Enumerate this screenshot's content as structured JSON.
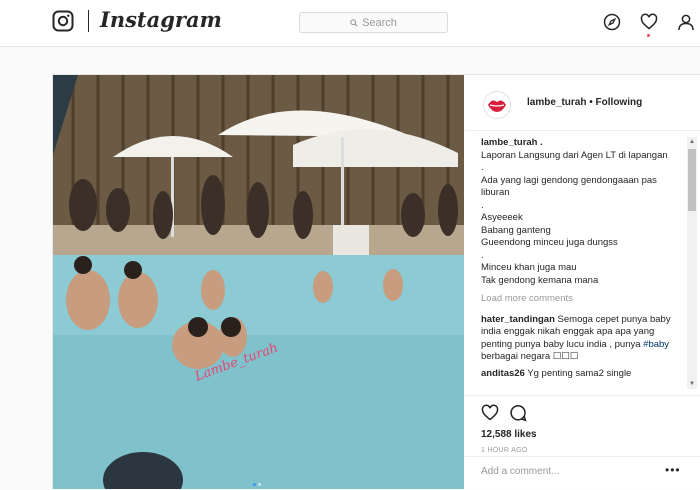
{
  "app": {
    "name": "Instagram",
    "search_placeholder": "Search"
  },
  "post": {
    "username": "lambe_turah",
    "follow_separator": "•",
    "follow_status": "Following",
    "caption_user": "lambe_turah",
    "caption_lines": [
      "lambe_turah .",
      "Laporan Langsung dari Agen LT di lapangan",
      ".",
      "Ada yang lagi gendong gendongaaan pas liburan",
      ".",
      "Asyeeeek",
      "Babang ganteng",
      "Gueendong minceu juga dungss",
      ".",
      "Minceu khan juga mau",
      "Tak gendong kemana mana"
    ],
    "load_more": "Load more comments",
    "comments": [
      {
        "user": "hater_tandingan",
        "text": "Semoga cepet punya baby india enggak nikah enggak apa apa yang penting punya baby lucu india , punya",
        "hashtag": "#baby",
        "text_after": "berbagai negara ☐☐☐"
      },
      {
        "user": "anditas26",
        "text": "Yg penting sama2 single"
      }
    ],
    "likes": "12,588 likes",
    "time": "1 HOUR AGO",
    "add_comment_placeholder": "Add a comment...",
    "more_label": "•••",
    "watermark": "Lambe_turah"
  }
}
